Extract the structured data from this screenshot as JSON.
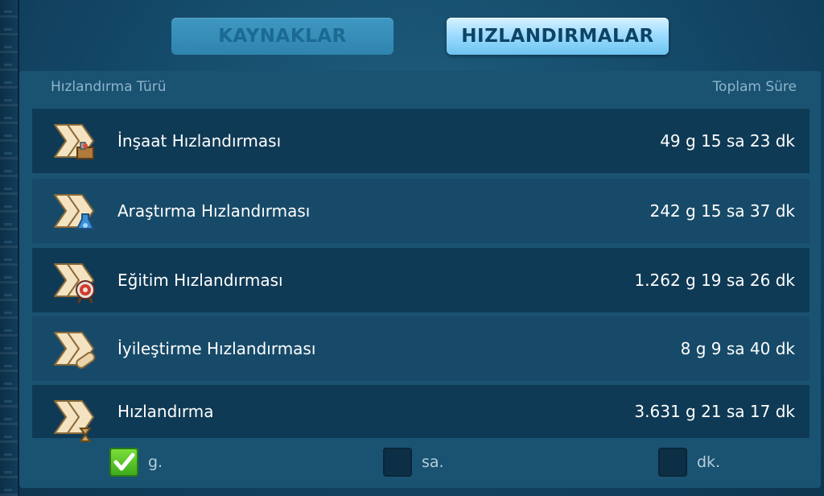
{
  "tabs": {
    "resources_label": "KAYNAKLAR",
    "speedups_label": "HIZLANDIRMALAR"
  },
  "table": {
    "col_type": "Hızlandırma Türü",
    "col_total": "Toplam Süre",
    "rows": [
      {
        "name": "İnşaat Hızlandırması",
        "total": "49 g 15 sa 23 dk",
        "icon": "construction-speedup-icon"
      },
      {
        "name": "Araştırma Hızlandırması",
        "total": "242 g 15 sa 37 dk",
        "icon": "research-speedup-icon"
      },
      {
        "name": "Eğitim Hızlandırması",
        "total": "1.262 g 19 sa 26 dk",
        "icon": "training-speedup-icon"
      },
      {
        "name": "İyileştirme Hızlandırması",
        "total": "8 g 9 sa 40 dk",
        "icon": "healing-speedup-icon"
      },
      {
        "name": "Hızlandırma",
        "total": "3.631 g 21 sa 17 dk",
        "icon": "universal-speedup-icon"
      }
    ]
  },
  "filters": {
    "days_label": "g.",
    "days_checked": true,
    "hours_label": "sa.",
    "hours_checked": false,
    "minutes_label": "dk.",
    "minutes_checked": false
  },
  "colors": {
    "active_tab": "#9fdcff",
    "check_green": "#5cc52b"
  }
}
